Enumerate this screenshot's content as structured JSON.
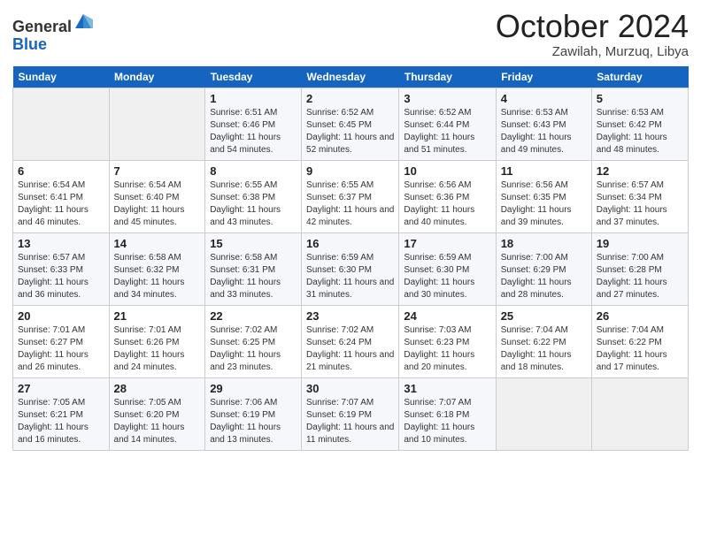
{
  "header": {
    "logo_general": "General",
    "logo_blue": "Blue",
    "month_title": "October 2024",
    "location": "Zawilah, Murzuq, Libya"
  },
  "weekdays": [
    "Sunday",
    "Monday",
    "Tuesday",
    "Wednesday",
    "Thursday",
    "Friday",
    "Saturday"
  ],
  "weeks": [
    [
      {
        "day": "",
        "sunrise": "",
        "sunset": "",
        "daylight": ""
      },
      {
        "day": "",
        "sunrise": "",
        "sunset": "",
        "daylight": ""
      },
      {
        "day": "1",
        "sunrise": "Sunrise: 6:51 AM",
        "sunset": "Sunset: 6:46 PM",
        "daylight": "Daylight: 11 hours and 54 minutes."
      },
      {
        "day": "2",
        "sunrise": "Sunrise: 6:52 AM",
        "sunset": "Sunset: 6:45 PM",
        "daylight": "Daylight: 11 hours and 52 minutes."
      },
      {
        "day": "3",
        "sunrise": "Sunrise: 6:52 AM",
        "sunset": "Sunset: 6:44 PM",
        "daylight": "Daylight: 11 hours and 51 minutes."
      },
      {
        "day": "4",
        "sunrise": "Sunrise: 6:53 AM",
        "sunset": "Sunset: 6:43 PM",
        "daylight": "Daylight: 11 hours and 49 minutes."
      },
      {
        "day": "5",
        "sunrise": "Sunrise: 6:53 AM",
        "sunset": "Sunset: 6:42 PM",
        "daylight": "Daylight: 11 hours and 48 minutes."
      }
    ],
    [
      {
        "day": "6",
        "sunrise": "Sunrise: 6:54 AM",
        "sunset": "Sunset: 6:41 PM",
        "daylight": "Daylight: 11 hours and 46 minutes."
      },
      {
        "day": "7",
        "sunrise": "Sunrise: 6:54 AM",
        "sunset": "Sunset: 6:40 PM",
        "daylight": "Daylight: 11 hours and 45 minutes."
      },
      {
        "day": "8",
        "sunrise": "Sunrise: 6:55 AM",
        "sunset": "Sunset: 6:38 PM",
        "daylight": "Daylight: 11 hours and 43 minutes."
      },
      {
        "day": "9",
        "sunrise": "Sunrise: 6:55 AM",
        "sunset": "Sunset: 6:37 PM",
        "daylight": "Daylight: 11 hours and 42 minutes."
      },
      {
        "day": "10",
        "sunrise": "Sunrise: 6:56 AM",
        "sunset": "Sunset: 6:36 PM",
        "daylight": "Daylight: 11 hours and 40 minutes."
      },
      {
        "day": "11",
        "sunrise": "Sunrise: 6:56 AM",
        "sunset": "Sunset: 6:35 PM",
        "daylight": "Daylight: 11 hours and 39 minutes."
      },
      {
        "day": "12",
        "sunrise": "Sunrise: 6:57 AM",
        "sunset": "Sunset: 6:34 PM",
        "daylight": "Daylight: 11 hours and 37 minutes."
      }
    ],
    [
      {
        "day": "13",
        "sunrise": "Sunrise: 6:57 AM",
        "sunset": "Sunset: 6:33 PM",
        "daylight": "Daylight: 11 hours and 36 minutes."
      },
      {
        "day": "14",
        "sunrise": "Sunrise: 6:58 AM",
        "sunset": "Sunset: 6:32 PM",
        "daylight": "Daylight: 11 hours and 34 minutes."
      },
      {
        "day": "15",
        "sunrise": "Sunrise: 6:58 AM",
        "sunset": "Sunset: 6:31 PM",
        "daylight": "Daylight: 11 hours and 33 minutes."
      },
      {
        "day": "16",
        "sunrise": "Sunrise: 6:59 AM",
        "sunset": "Sunset: 6:30 PM",
        "daylight": "Daylight: 11 hours and 31 minutes."
      },
      {
        "day": "17",
        "sunrise": "Sunrise: 6:59 AM",
        "sunset": "Sunset: 6:30 PM",
        "daylight": "Daylight: 11 hours and 30 minutes."
      },
      {
        "day": "18",
        "sunrise": "Sunrise: 7:00 AM",
        "sunset": "Sunset: 6:29 PM",
        "daylight": "Daylight: 11 hours and 28 minutes."
      },
      {
        "day": "19",
        "sunrise": "Sunrise: 7:00 AM",
        "sunset": "Sunset: 6:28 PM",
        "daylight": "Daylight: 11 hours and 27 minutes."
      }
    ],
    [
      {
        "day": "20",
        "sunrise": "Sunrise: 7:01 AM",
        "sunset": "Sunset: 6:27 PM",
        "daylight": "Daylight: 11 hours and 26 minutes."
      },
      {
        "day": "21",
        "sunrise": "Sunrise: 7:01 AM",
        "sunset": "Sunset: 6:26 PM",
        "daylight": "Daylight: 11 hours and 24 minutes."
      },
      {
        "day": "22",
        "sunrise": "Sunrise: 7:02 AM",
        "sunset": "Sunset: 6:25 PM",
        "daylight": "Daylight: 11 hours and 23 minutes."
      },
      {
        "day": "23",
        "sunrise": "Sunrise: 7:02 AM",
        "sunset": "Sunset: 6:24 PM",
        "daylight": "Daylight: 11 hours and 21 minutes."
      },
      {
        "day": "24",
        "sunrise": "Sunrise: 7:03 AM",
        "sunset": "Sunset: 6:23 PM",
        "daylight": "Daylight: 11 hours and 20 minutes."
      },
      {
        "day": "25",
        "sunrise": "Sunrise: 7:04 AM",
        "sunset": "Sunset: 6:22 PM",
        "daylight": "Daylight: 11 hours and 18 minutes."
      },
      {
        "day": "26",
        "sunrise": "Sunrise: 7:04 AM",
        "sunset": "Sunset: 6:22 PM",
        "daylight": "Daylight: 11 hours and 17 minutes."
      }
    ],
    [
      {
        "day": "27",
        "sunrise": "Sunrise: 7:05 AM",
        "sunset": "Sunset: 6:21 PM",
        "daylight": "Daylight: 11 hours and 16 minutes."
      },
      {
        "day": "28",
        "sunrise": "Sunrise: 7:05 AM",
        "sunset": "Sunset: 6:20 PM",
        "daylight": "Daylight: 11 hours and 14 minutes."
      },
      {
        "day": "29",
        "sunrise": "Sunrise: 7:06 AM",
        "sunset": "Sunset: 6:19 PM",
        "daylight": "Daylight: 11 hours and 13 minutes."
      },
      {
        "day": "30",
        "sunrise": "Sunrise: 7:07 AM",
        "sunset": "Sunset: 6:19 PM",
        "daylight": "Daylight: 11 hours and 11 minutes."
      },
      {
        "day": "31",
        "sunrise": "Sunrise: 7:07 AM",
        "sunset": "Sunset: 6:18 PM",
        "daylight": "Daylight: 11 hours and 10 minutes."
      },
      {
        "day": "",
        "sunrise": "",
        "sunset": "",
        "daylight": ""
      },
      {
        "day": "",
        "sunrise": "",
        "sunset": "",
        "daylight": ""
      }
    ]
  ]
}
